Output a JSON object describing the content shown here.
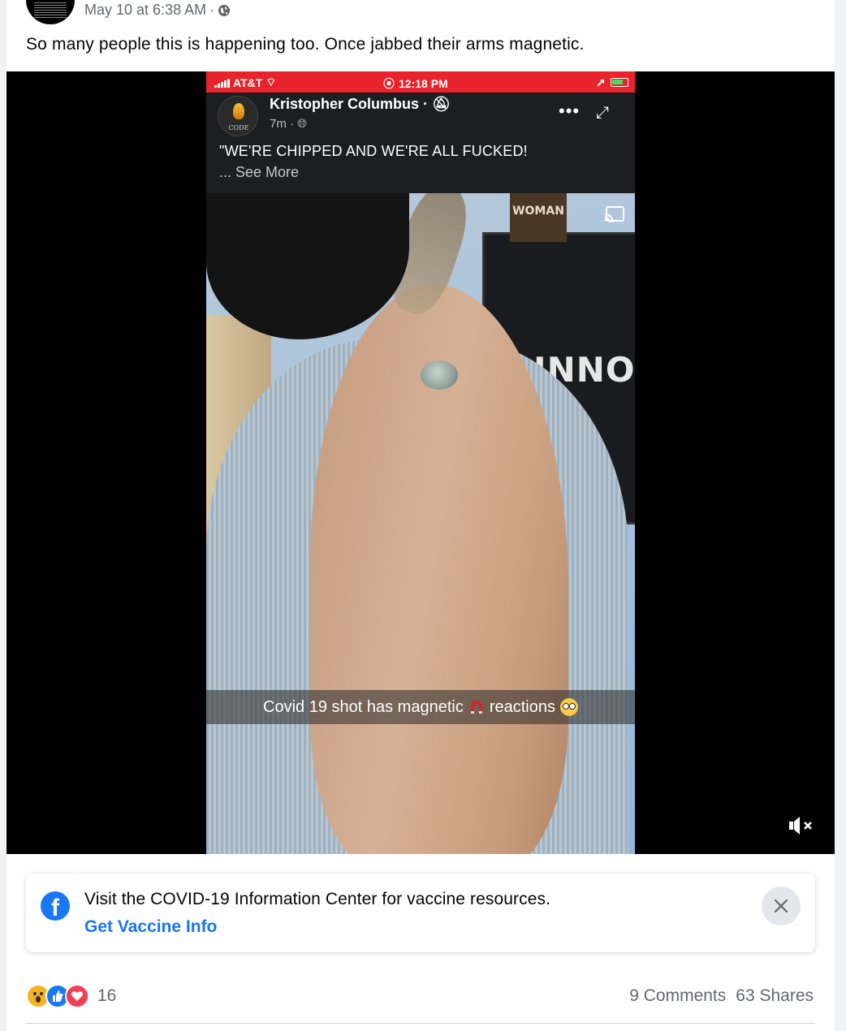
{
  "post": {
    "timestamp": "May 10 at 6:38 AM",
    "separator": "·",
    "text": "So many people this is happening too. Once jabbed their arms magnetic."
  },
  "video": {
    "status_bar": {
      "carrier": "AT&T",
      "time": "12:18 PM"
    },
    "shared_post": {
      "page_name": "Kristopher Columbus",
      "page_avatar_text": "CODE",
      "time": "7m",
      "quote": "\"WE'RE CHIPPED AND WE'RE ALL FUCKED!",
      "see_more": "... See More"
    },
    "background": {
      "poster_text": "WOMAN",
      "tv_text": "INNOCE"
    },
    "caption": {
      "before": "Covid 19 shot has magnetic",
      "after": "reactions"
    }
  },
  "info_center": {
    "message": "Visit the COVID-19 Information Center for vaccine resources.",
    "link": "Get Vaccine Info"
  },
  "footer": {
    "reaction_count": "16",
    "comments": "9 Comments",
    "shares": "63 Shares"
  },
  "colors": {
    "brand_blue": "#1877f2",
    "status_bar_red": "#e8232b",
    "secondary_text": "#65676b"
  }
}
